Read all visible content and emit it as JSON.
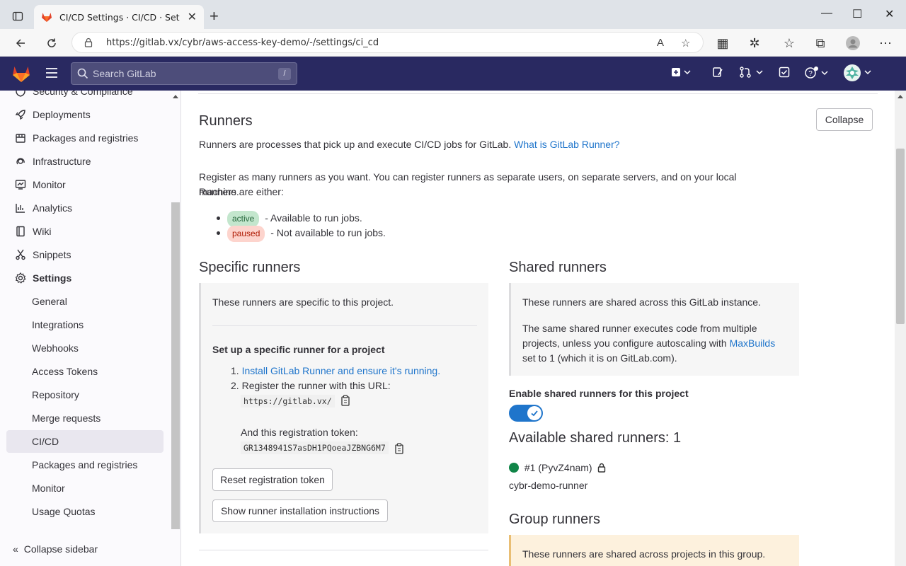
{
  "browser": {
    "tab_title": "CI/CD Settings · CI/CD · Settings",
    "url": "https://gitlab.vx/cybr/aws-access-key-demo/-/settings/ci_cd"
  },
  "gitlab_nav": {
    "search_placeholder": "Search GitLab",
    "search_shortcut": "/"
  },
  "sidebar": {
    "items": [
      {
        "label": "Security & Compliance",
        "icon": "shield-icon"
      },
      {
        "label": "Deployments",
        "icon": "rocket-icon"
      },
      {
        "label": "Packages and registries",
        "icon": "package-icon"
      },
      {
        "label": "Infrastructure",
        "icon": "cloud-gear-icon"
      },
      {
        "label": "Monitor",
        "icon": "monitor-icon"
      },
      {
        "label": "Analytics",
        "icon": "chart-icon"
      },
      {
        "label": "Wiki",
        "icon": "book-icon"
      },
      {
        "label": "Snippets",
        "icon": "scissors-icon"
      },
      {
        "label": "Settings",
        "icon": "gear-icon"
      }
    ],
    "settings_sub": [
      {
        "label": "General"
      },
      {
        "label": "Integrations"
      },
      {
        "label": "Webhooks"
      },
      {
        "label": "Access Tokens"
      },
      {
        "label": "Repository"
      },
      {
        "label": "Merge requests"
      },
      {
        "label": "CI/CD"
      },
      {
        "label": "Packages and registries"
      },
      {
        "label": "Monitor"
      },
      {
        "label": "Usage Quotas"
      }
    ],
    "collapse_label": "Collapse sidebar"
  },
  "runners": {
    "title": "Runners",
    "collapse_button": "Collapse",
    "intro_text": "Runners are processes that pick up and execute CI/CD jobs for GitLab.",
    "intro_link": "What is GitLab Runner?",
    "register_text_1": "Register as many runners as you want. You can register runners as separate users, on separate servers, and on your local machine.",
    "register_text_2": "Runners are either:",
    "badge_active": "active",
    "badge_active_desc": "- Available to run jobs.",
    "badge_paused": "paused",
    "badge_paused_desc": "- Not available to run jobs."
  },
  "specific": {
    "title": "Specific runners",
    "desc": "These runners are specific to this project.",
    "setup_title": "Set up a specific runner for a project",
    "step1_num": "1.",
    "step1_link": "Install GitLab Runner and ensure it's running.",
    "step2_num": "2.",
    "step2_text": "Register the runner with this URL:",
    "url_value": "https://gitlab.vx/",
    "token_label": "And this registration token:",
    "token_value": "GR1348941S7asDH1PQoeaJZBNG6M7",
    "reset_button": "Reset registration token",
    "show_button": "Show runner installation instructions"
  },
  "shared": {
    "title": "Shared runners",
    "desc": "These runners are shared across this GitLab instance.",
    "desc2_a": "The same shared runner executes code from multiple projects, unless you configure autoscaling with",
    "desc2_link": "MaxBuilds",
    "desc2_b": "set to 1 (which it is on GitLab.com).",
    "enable_label": "Enable shared runners for this project",
    "enabled": true,
    "available_title": "Available shared runners: 1",
    "runner_id": "#1 (PyvZ4nam)",
    "runner_name": "cybr-demo-runner"
  },
  "group": {
    "title": "Group runners",
    "desc": "These runners are shared across projects in this group."
  }
}
